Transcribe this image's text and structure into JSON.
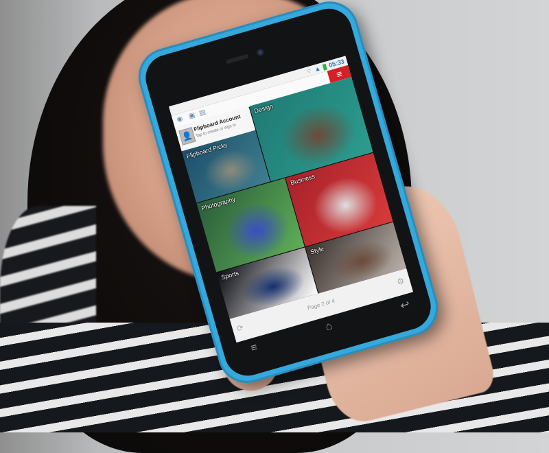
{
  "status_bar": {
    "time": "05:33",
    "wifi_icon": "wifi-icon",
    "signal_icon": "signal-icon",
    "battery_icon": "battery-icon"
  },
  "toolbar": {
    "icons": [
      "profile-icon",
      "photo-icon",
      "cover-icon"
    ],
    "menu_icon": "hamburger-menu-icon"
  },
  "account": {
    "title": "Flipboard Account",
    "subtitle": "Tap to create or sign in"
  },
  "tiles": [
    {
      "label": "Flipboard Picks",
      "colors": [
        "#1c4f6b",
        "#3f7f8e",
        "#8c8c7c"
      ]
    },
    {
      "label": "Design",
      "colors": [
        "#1f7a74",
        "#2c9c8f",
        "#6c4a38"
      ]
    },
    {
      "label": "Photography",
      "colors": [
        "#2a5d3a",
        "#5fae58",
        "#3a4dc6"
      ]
    },
    {
      "label": "Business",
      "colors": [
        "#a8222a",
        "#d63a3a",
        "#dedede"
      ]
    },
    {
      "label": "Sports",
      "colors": [
        "#0b0b14",
        "#ffffff",
        "#13306e"
      ]
    },
    {
      "label": "Style",
      "colors": [
        "#3b3230",
        "#b9b1a8",
        "#6b4a3a"
      ]
    }
  ],
  "bottom_bar": {
    "page_indicator": "Page 2 of 4",
    "refresh_icon": "refresh-icon",
    "settings_icon": "gear-icon"
  },
  "nav_bar": {
    "menu": "≡",
    "home": "⌂",
    "back": "↩"
  },
  "colors": {
    "phone_body": "#35a8dc",
    "flipboard_red": "#d51f26"
  }
}
